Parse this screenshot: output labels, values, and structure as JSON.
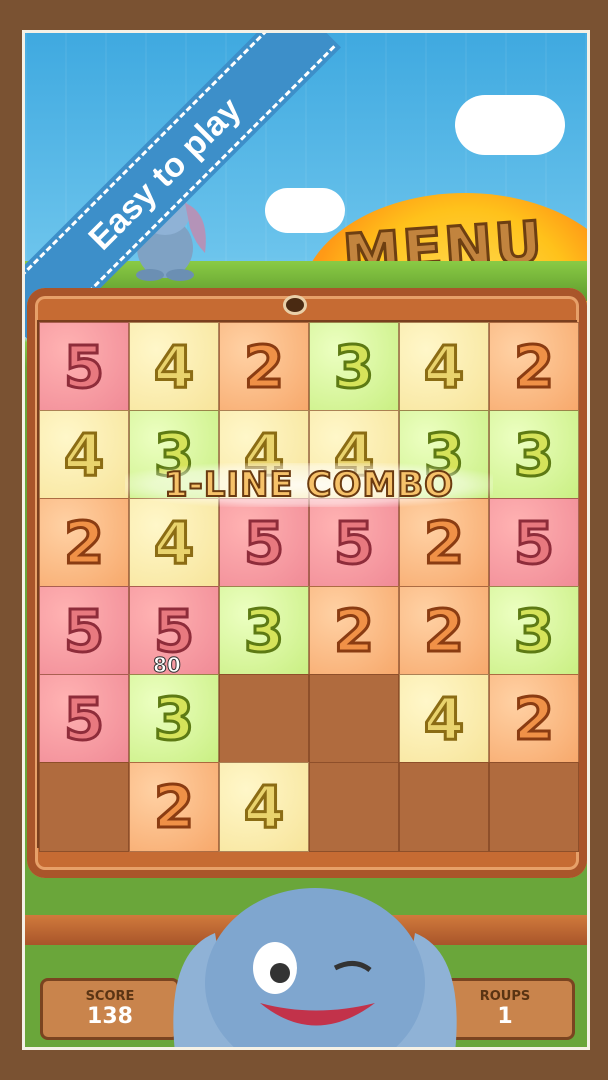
{
  "banner": {
    "text": "Easy to play"
  },
  "menu": {
    "label": "MENU"
  },
  "board": {
    "rows": [
      [
        "5",
        "4",
        "2",
        "3",
        "4",
        "2"
      ],
      [
        "4",
        "3",
        "4",
        "4",
        "3",
        "3"
      ],
      [
        "2",
        "4",
        "5",
        "5",
        "2",
        "5"
      ],
      [
        "5",
        "5",
        "3",
        "2",
        "2",
        "3"
      ],
      [
        "5",
        "3",
        "",
        "",
        "4",
        "2"
      ],
      [
        "",
        "2",
        "4",
        "",
        "",
        ""
      ]
    ]
  },
  "combo": {
    "text": "1-LINE COMBO"
  },
  "points_popup": "80",
  "score": {
    "label": "SCORE",
    "value": "138"
  },
  "groups": {
    "label": "ROUPS",
    "value": "1"
  }
}
